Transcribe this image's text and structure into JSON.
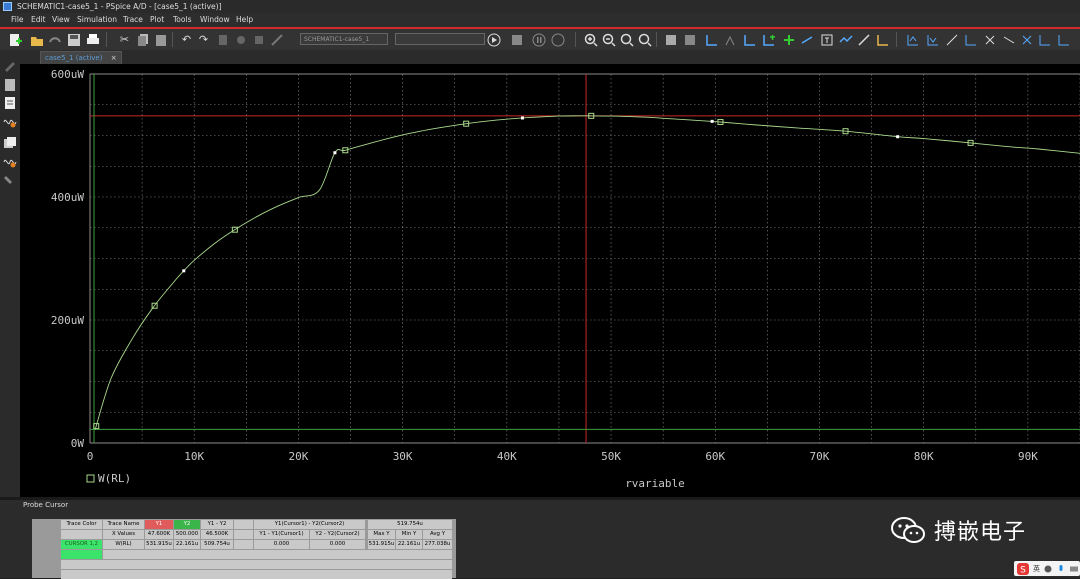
{
  "window": {
    "title": "SCHEMATIC1-case5_1 - PSpice A/D  - [case5_1 (active)]"
  },
  "menu": [
    "File",
    "Edit",
    "View",
    "Simulation",
    "Trace",
    "Plot",
    "Tools",
    "Window",
    "Help"
  ],
  "toolbar": {
    "profile_combo": "SCHEMATIC1-case5_1",
    "search_combo": ""
  },
  "tab": {
    "label": "case5_1 (active)",
    "close": "×"
  },
  "colors": {
    "background": "#000000",
    "grid": "#8c8c8c",
    "trace": "#a9d98c",
    "cursor1": "#c62828",
    "cursor2": "#3aa13a",
    "axis_text": "#c8c8c8"
  },
  "chart_data": {
    "type": "line",
    "title": "",
    "xlabel": "rvariable",
    "ylabel": "",
    "xlim": [
      0,
      95000
    ],
    "ylim": [
      0,
      600
    ],
    "y_unit": "uW",
    "x_ticks": [
      0,
      10000,
      20000,
      30000,
      40000,
      50000,
      60000,
      70000,
      80000,
      90000
    ],
    "x_tick_labels": [
      "0",
      "10K",
      "20K",
      "30K",
      "40K",
      "50K",
      "60K",
      "70K",
      "80K",
      "90K"
    ],
    "y_ticks": [
      0,
      200,
      400,
      600
    ],
    "y_tick_labels": [
      "0W",
      "200uW",
      "400uW",
      "600uW"
    ],
    "grid": true,
    "series": [
      {
        "name": "W(RL)",
        "x": [
          500,
          2000,
          4000,
          6000,
          8000,
          9000,
          10000,
          12000,
          14000,
          16000,
          18000,
          20000,
          22000,
          23500,
          24500,
          27000,
          30000,
          33000,
          36000,
          39000,
          41000,
          43000,
          45000,
          47000,
          48000,
          50000,
          53000,
          56000,
          59700,
          60500,
          64000,
          68000,
          72500,
          77500,
          80000,
          84500,
          88000,
          91000,
          95000
        ],
        "y": [
          22,
          104,
          168,
          219,
          261,
          280,
          297,
          325,
          348,
          368,
          385,
          399,
          411,
          472,
          476,
          488,
          501,
          511,
          519,
          525,
          528,
          530,
          531.5,
          532,
          532,
          531.5,
          530,
          527,
          523,
          522,
          517,
          512,
          507,
          498,
          495,
          488,
          482,
          478,
          471
        ]
      }
    ],
    "markers_square_x": [
      600,
      6200,
      13900,
      24500,
      36100,
      48100,
      60500,
      72500,
      84500
    ],
    "markers_dot_x": [
      9000,
      23500,
      41500,
      59700,
      77500
    ],
    "cursors": {
      "cursor1_x": 47600,
      "cursor2_y": 22.161
    },
    "legend": {
      "placement": "bottom-left",
      "entries": [
        "W(RL)"
      ]
    }
  },
  "probe_cursor": {
    "title": "Probe Cursor",
    "header_row1": [
      "Trace Color",
      "Trace Name",
      "Y1",
      "Y2",
      "Y1 - Y2",
      "",
      "Y1(Cursor1) - Y2(Cursor2)",
      "",
      "519.754u",
      "",
      "",
      ""
    ],
    "header_row2": [
      "",
      "X Values",
      "47.600K",
      "500.000",
      "46.500K",
      "Y1 - Y1(Cursor1)",
      "Y2 - Y2(Cursor2)",
      "",
      "Max Y",
      "Min Y",
      "Avg Y"
    ],
    "row_cursor1": [
      "CURSOR 1,2",
      "W(RL)",
      "531.915u",
      "22.161u",
      "509.754u",
      "0.000",
      "0.000",
      "",
      "531.915u",
      "22.161u",
      "277.038u"
    ]
  },
  "watermark": {
    "text": "搏嵌电子"
  },
  "ime": {
    "label": "英"
  }
}
